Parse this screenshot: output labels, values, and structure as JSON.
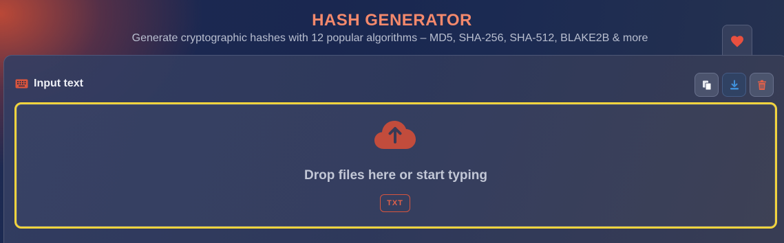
{
  "header": {
    "title": "HASH GENERATOR",
    "subtitle": "Generate cryptographic hashes with 12 popular algorithms – MD5, SHA-256, SHA-512, BLAKE2B & more"
  },
  "favorite": {
    "icon": "heart-icon",
    "color": "#e9503f"
  },
  "input_panel": {
    "label": "Input text",
    "label_icon": "keyboard-icon",
    "toolbar": [
      {
        "name": "paste",
        "icon": "paste-icon"
      },
      {
        "name": "download",
        "icon": "download-icon"
      },
      {
        "name": "clear",
        "icon": "trash-icon"
      }
    ],
    "dropzone": {
      "icon": "cloud-upload-icon",
      "text": "Drop files here or start typing",
      "badge": "TXT",
      "highlight_color": "#f2d43e"
    }
  },
  "colors": {
    "accent": "#f4896c",
    "danger": "#e0614a",
    "info": "#3f8fd8"
  }
}
